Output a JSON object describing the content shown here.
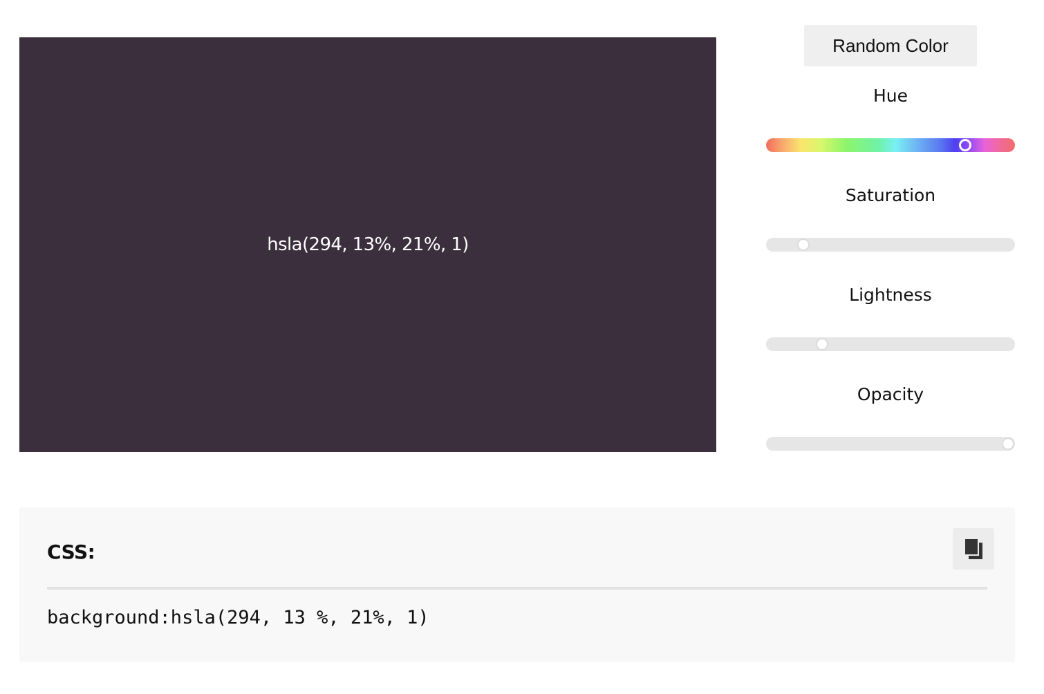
{
  "color": {
    "hue": 294,
    "saturation": 13,
    "lightness": 21,
    "opacity": 1,
    "swatch_hex": "#3b2e3c"
  },
  "preview": {
    "label": "hsla(294, 13%, 21%, 1)"
  },
  "controls": {
    "random_button_label": "Random Color",
    "sliders": {
      "hue": {
        "label": "Hue",
        "value": 294,
        "max": 360
      },
      "saturation": {
        "label": "Saturation",
        "value": 13,
        "max": 100
      },
      "lightness": {
        "label": "Lightness",
        "value": 21,
        "max": 100
      },
      "opacity": {
        "label": "Opacity",
        "value": 1,
        "max": 1
      }
    }
  },
  "css_panel": {
    "title": "CSS:",
    "code": "background:hsla(294, 13 %, 21%, 1)",
    "copy_icon": "copy-icon"
  }
}
